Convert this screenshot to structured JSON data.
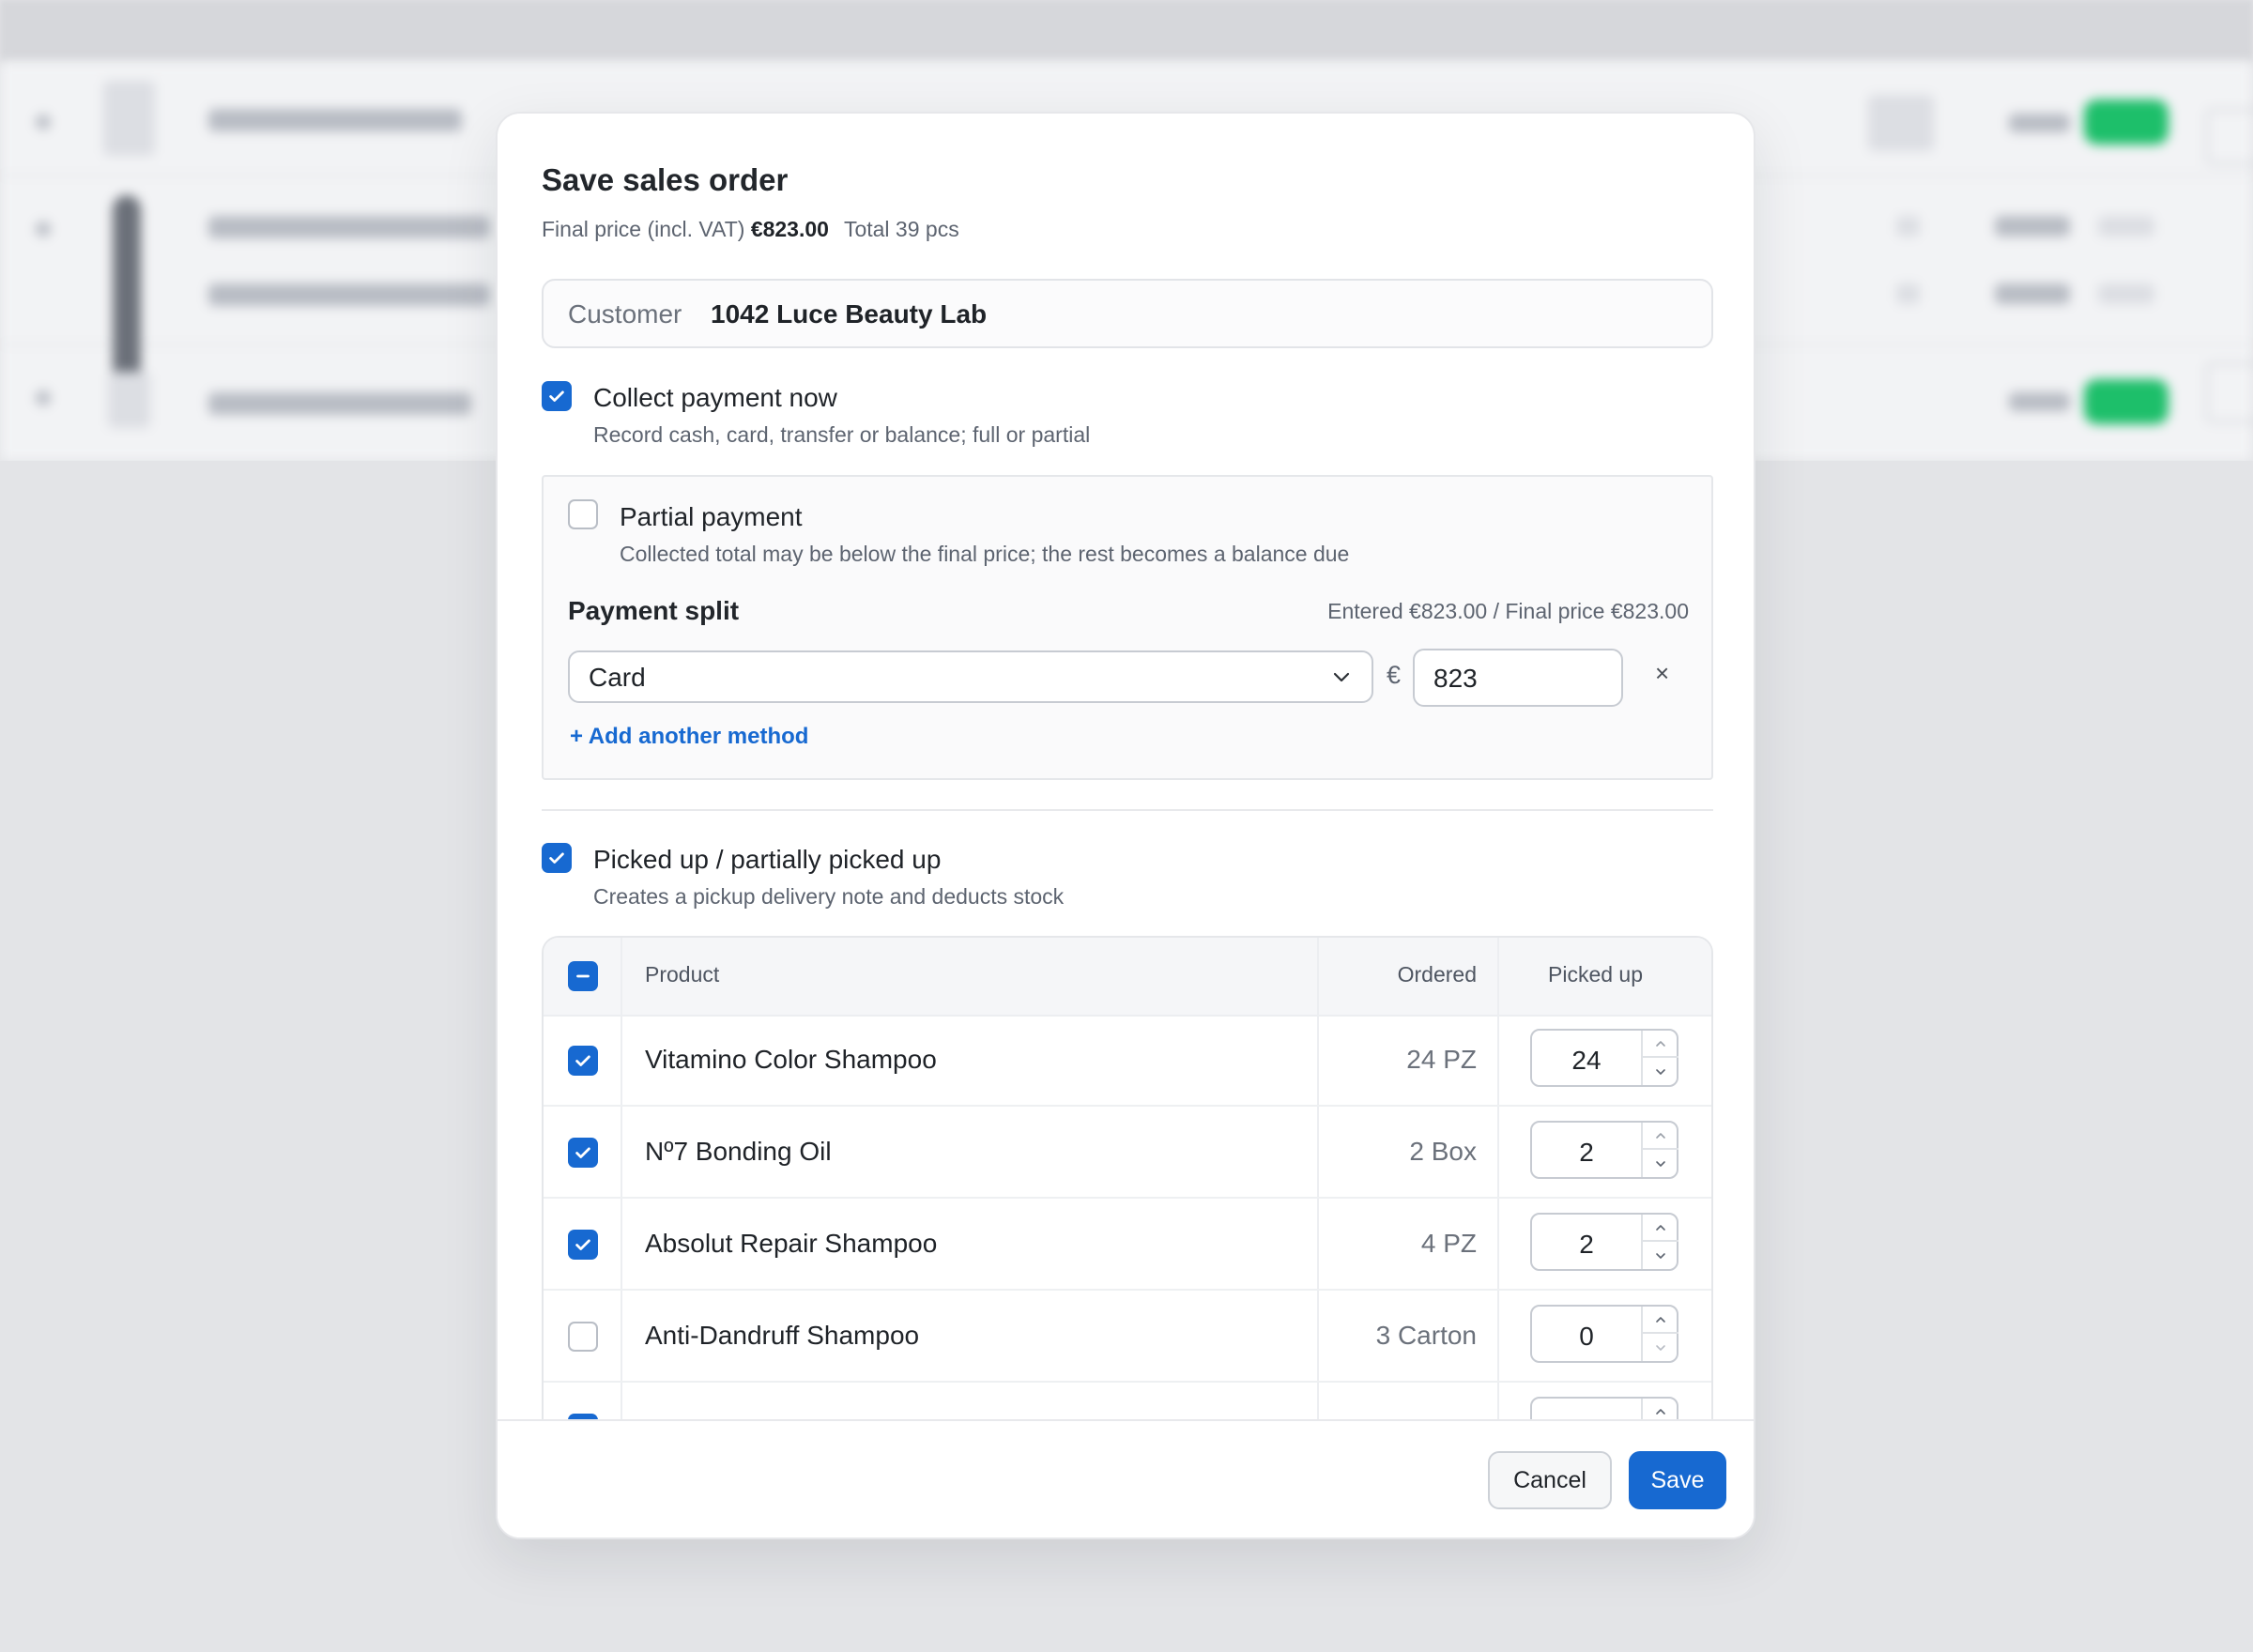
{
  "modal": {
    "title": "Save sales order",
    "summary": {
      "final_label": "Final price (incl. VAT)",
      "final_value": "€823.00",
      "total_label": "Total 39 pcs"
    },
    "customer": {
      "label": "Customer",
      "value": "1042 Luce Beauty Lab"
    },
    "collect_payment": {
      "checked": true,
      "title": "Collect payment now",
      "description": "Record cash, card, transfer or balance; full or partial"
    },
    "partial_payment": {
      "checked": false,
      "title": "Partial payment",
      "description": "Collected total may be below the final price; the rest becomes a balance due"
    },
    "payment_split": {
      "label": "Payment split",
      "status": "Entered €823.00 / Final price €823.00",
      "method": "Card",
      "currency_symbol": "€",
      "amount": "823",
      "remove_symbol": "×",
      "add_method": "+ Add another method"
    },
    "picked_up": {
      "checked": true,
      "title": "Picked up / partially picked up",
      "description": "Creates a pickup delivery note and deducts stock"
    },
    "table": {
      "headers": {
        "product": "Product",
        "ordered": "Ordered",
        "picked": "Picked up"
      },
      "rows": [
        {
          "checked": true,
          "product": "Vitamino Color Shampoo",
          "ordered": "24 PZ",
          "picked": "24"
        },
        {
          "checked": true,
          "product": "Nº7 Bonding Oil",
          "ordered": "2 Box",
          "picked": "2"
        },
        {
          "checked": true,
          "product": "Absolut Repair Shampoo",
          "ordered": "4 PZ",
          "picked": "2"
        },
        {
          "checked": false,
          "product": "Anti-Dandruff Shampoo",
          "ordered": "3 Carton",
          "picked": "0"
        }
      ]
    },
    "footer": {
      "cancel": "Cancel",
      "save": "Save"
    }
  },
  "colors": {
    "accent": "#1769d1",
    "success": "#1dbf6a",
    "text": "#1f2328",
    "muted": "#5d6470"
  },
  "icons": [
    "check-icon",
    "minus-icon",
    "chevron-down-icon",
    "chevron-up-icon",
    "close-icon"
  ]
}
